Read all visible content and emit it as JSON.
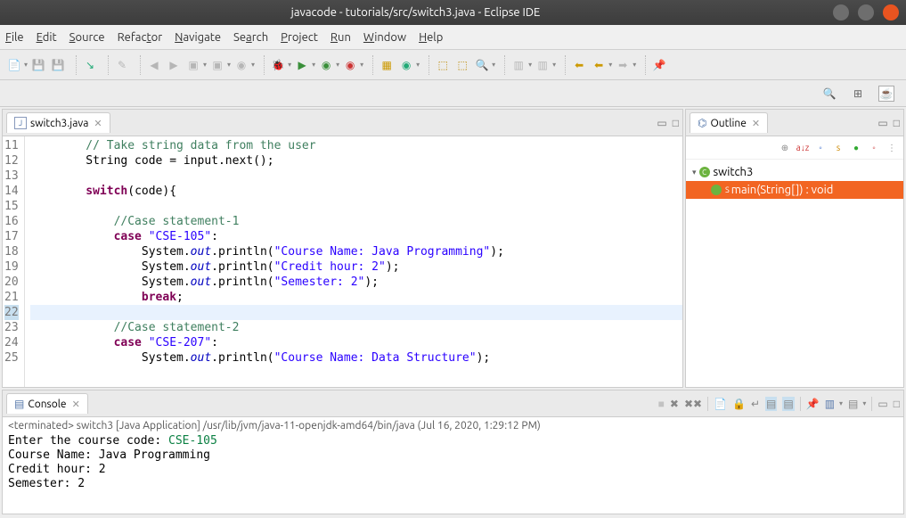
{
  "window": {
    "title": "javacode - tutorials/src/switch3.java - Eclipse IDE"
  },
  "menu": {
    "items": [
      "File",
      "Edit",
      "Source",
      "Refactor",
      "Navigate",
      "Search",
      "Project",
      "Run",
      "Window",
      "Help"
    ]
  },
  "editor": {
    "tab_label": "switch3.java",
    "first_line": 11,
    "lines": [
      {
        "n": 11,
        "t": "        // Take string data from the user",
        "cls": "c"
      },
      {
        "n": 12,
        "t": "        String code = input.next();"
      },
      {
        "n": 13,
        "t": ""
      },
      {
        "n": 14,
        "t": "        switch(code){",
        "sw": true
      },
      {
        "n": 15,
        "t": ""
      },
      {
        "n": 16,
        "t": "            //Case statement-1",
        "cls": "c"
      },
      {
        "n": 17,
        "t": "            case \"CSE-105\":",
        "cs": true
      },
      {
        "n": 18,
        "t": "                System.out.println(\"Course Name: Java Programming\");",
        "po": true
      },
      {
        "n": 19,
        "t": "                System.out.println(\"Credit hour: 2\");",
        "po": true
      },
      {
        "n": 20,
        "t": "                System.out.println(\"Semester: 2\");",
        "po": true
      },
      {
        "n": 21,
        "t": "                break;",
        "br": true
      },
      {
        "n": 22,
        "t": "",
        "cl": true
      },
      {
        "n": 23,
        "t": "            //Case statement-2",
        "cls": "c"
      },
      {
        "n": 24,
        "t": "            case \"CSE-207\":",
        "cs": true
      },
      {
        "n": 25,
        "t": "                System.out.println(\"Course Name: Data Structure\");",
        "po": true
      }
    ]
  },
  "outline": {
    "title": "Outline",
    "class_name": "switch3",
    "method": "main(String[]) : void"
  },
  "console": {
    "title": "Console",
    "header": "<terminated> switch3 [Java Application] /usr/lib/jvm/java-11-openjdk-amd64/bin/java (Jul 16, 2020, 1:29:12 PM)",
    "lines": [
      {
        "pre": "Enter the course code: ",
        "in": "CSE-105"
      },
      {
        "t": "Course Name: Java Programming"
      },
      {
        "t": "Credit hour: 2"
      },
      {
        "t": "Semester: 2"
      }
    ]
  }
}
